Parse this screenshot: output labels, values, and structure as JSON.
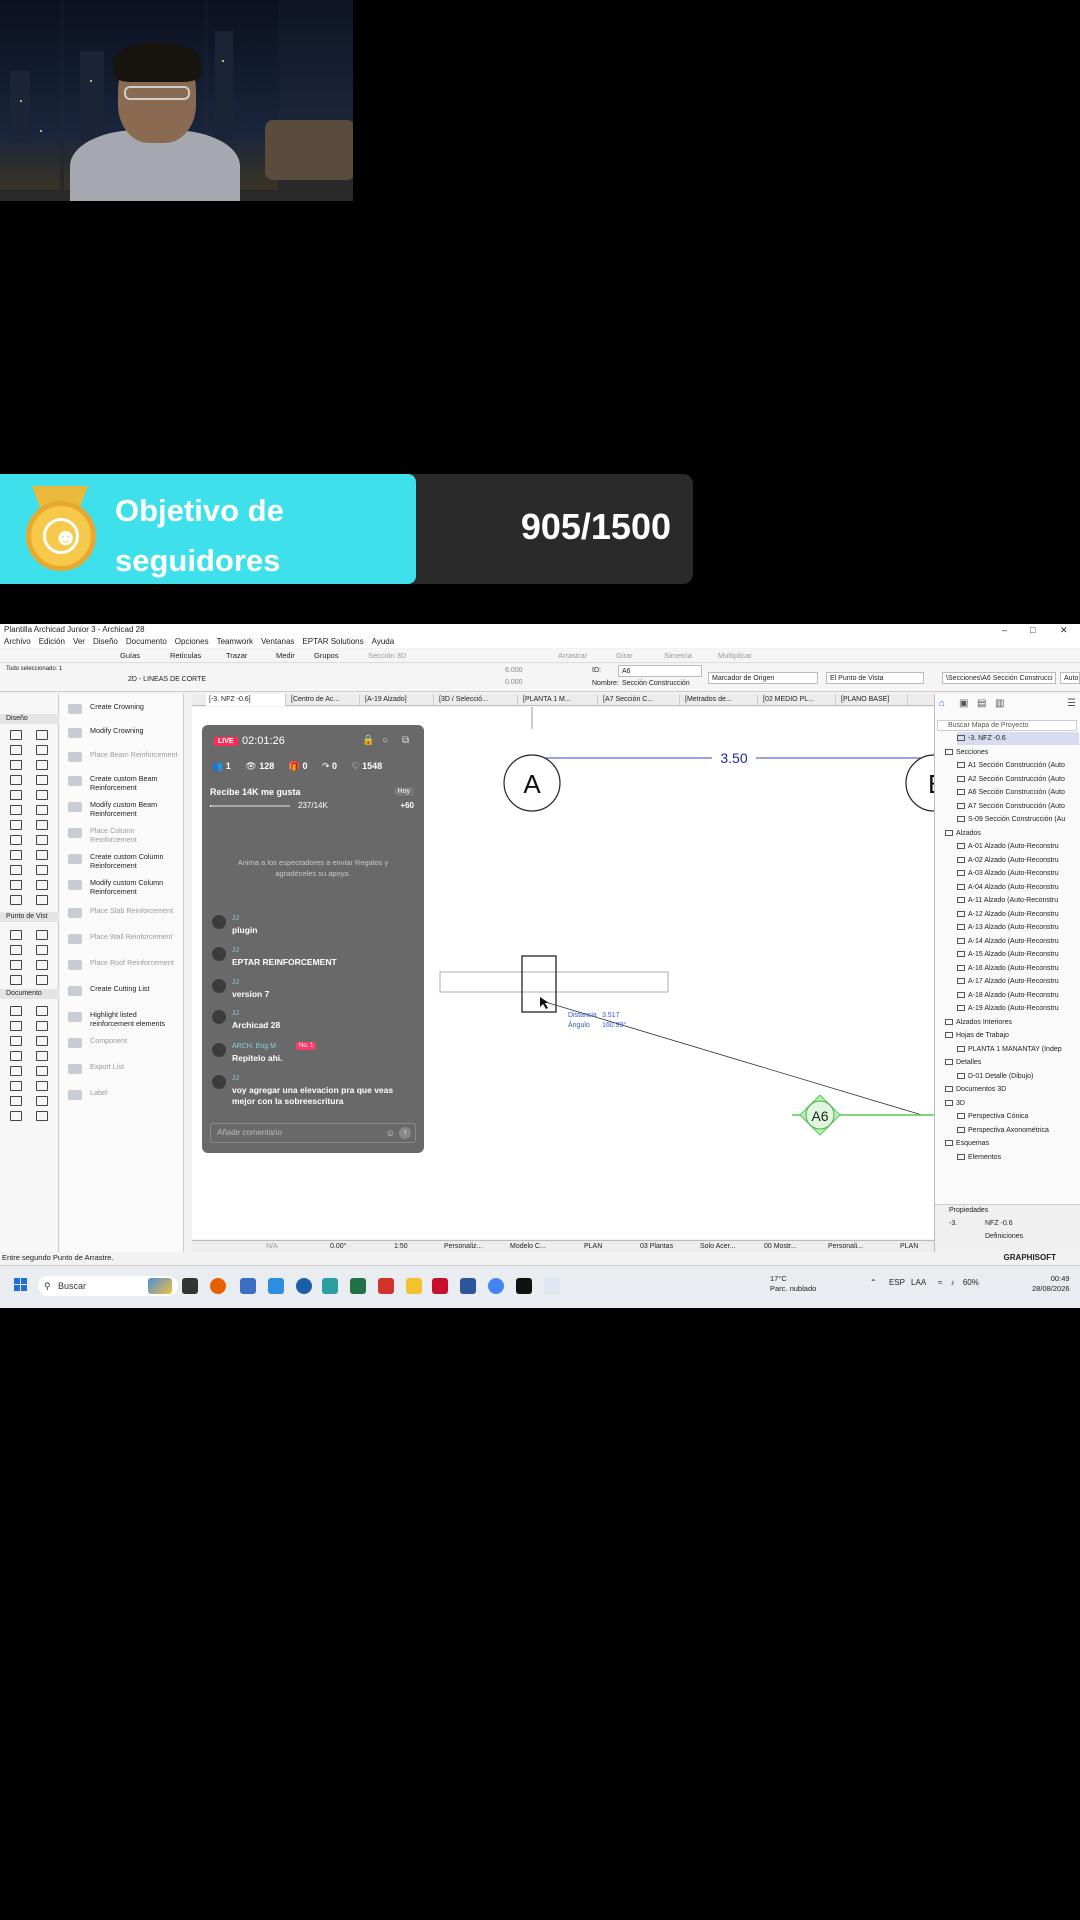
{
  "goal": {
    "title": "Objetivo de seguidores",
    "count": "905/1500"
  },
  "app": {
    "window_title": "Plantilla Archicad Junior 3 - Archicad 28",
    "menu": [
      "Archivo",
      "Edición",
      "Ver",
      "Diseño",
      "Documento",
      "Opciones",
      "Teamwork",
      "Ventanas",
      "EPTAR Solutions",
      "Ayuda"
    ],
    "toolbar": {
      "guides": "Guías",
      "grids": "Retículas",
      "trace": "Trazar",
      "measure": "Medir",
      "groups": "Grupos",
      "section3d": "Sección 3D",
      "drag": "Arrastrar",
      "rotate": "Girar",
      "mirror": "Simetría",
      "multiply": "Multiplicar"
    },
    "infobox": {
      "all_selected": "Todo seleccionado: 1",
      "view_2d": "2D - LINEAS DE CORTE",
      "val_a": "6.000",
      "val_b": "0.000",
      "id_label": "ID:",
      "id_value": "A6",
      "name_label": "Nombre:",
      "name_value": "Sección Construcción",
      "marker": "Marcador de Origen",
      "viewpoint": "El Punto de Vista",
      "path": "\\Secciones\\A6 Sección Construcci",
      "auto": "Auto"
    },
    "toolbox_sections": [
      "Diseño",
      "Punto de Vist",
      "Documento"
    ],
    "palette": [
      {
        "label": "Create Crowning",
        "dim": false
      },
      {
        "label": "Modify Crowning",
        "dim": false
      },
      {
        "label": "Place Beam Reinforcement",
        "dim": true
      },
      {
        "label": "Create custom Beam Reinforcement",
        "dim": false
      },
      {
        "label": "Modify custom Beam Reinforcement",
        "dim": false
      },
      {
        "label": "Place Column Reinforcement",
        "dim": true
      },
      {
        "label": "Create custom Column Reinforcement",
        "dim": false
      },
      {
        "label": "Modify custom Column Reinforcement",
        "dim": false
      },
      {
        "label": "Place Slab Reinforcement",
        "dim": true
      },
      {
        "label": "Place Wall Reinforcement",
        "dim": true
      },
      {
        "label": "Place Roof Reinforcement",
        "dim": true
      },
      {
        "label": "Create Cutting List",
        "dim": false
      },
      {
        "label": "Highlight listed reinforcement elements",
        "dim": false
      },
      {
        "label": "Component",
        "dim": true
      },
      {
        "label": "Export List",
        "dim": true
      },
      {
        "label": "Label",
        "dim": true
      }
    ],
    "tabs": [
      "[-3. NFZ -0.6]",
      "[Centro de Ac...",
      "[A-19 Alzado]",
      "[3D / Selecció...",
      "[PLANTA 1 M...",
      "[A7 Sección C...",
      "[Metrados de...",
      "[02 MEDIO PL...",
      "[PLANO BASE]"
    ],
    "canvas": {
      "dimension": "3.50",
      "grid_a": "A",
      "grid_b": "B",
      "marker": "A6",
      "tracker_dist_label": "Distancia",
      "tracker_dist": "3.517",
      "tracker_angle_label": "Ángulo",
      "tracker_angle": "160.99°"
    },
    "navigator": {
      "search_placeholder": "Buscar Mapa de Proyecto",
      "items": [
        {
          "label": "-3. NFZ -0.6",
          "indent": 1,
          "sel": true
        },
        {
          "label": "Secciones",
          "indent": 0,
          "sel": false
        },
        {
          "label": "A1 Sección Construcción (Auto",
          "indent": 1,
          "sel": false
        },
        {
          "label": "A2 Sección Construcción (Auto",
          "indent": 1,
          "sel": false
        },
        {
          "label": "A6 Sección Construcción (Auto",
          "indent": 1,
          "sel": false
        },
        {
          "label": "A7 Sección Construcción (Auto",
          "indent": 1,
          "sel": false
        },
        {
          "label": "S-09 Sección Construcción (Au",
          "indent": 1,
          "sel": false
        },
        {
          "label": "Alzados",
          "indent": 0,
          "sel": false
        },
        {
          "label": "A-01 Alzado (Auto-Reconstru",
          "indent": 1,
          "sel": false
        },
        {
          "label": "A-02 Alzado (Auto-Reconstru",
          "indent": 1,
          "sel": false
        },
        {
          "label": "A-03 Alzado (Auto-Reconstru",
          "indent": 1,
          "sel": false
        },
        {
          "label": "A-04 Alzado (Auto-Reconstru",
          "indent": 1,
          "sel": false
        },
        {
          "label": "A-11 Alzado (Auto-Reconstru",
          "indent": 1,
          "sel": false
        },
        {
          "label": "A-12 Alzado (Auto-Reconstru",
          "indent": 1,
          "sel": false
        },
        {
          "label": "A-13 Alzado (Auto-Reconstru",
          "indent": 1,
          "sel": false
        },
        {
          "label": "A-14 Alzado (Auto-Reconstru",
          "indent": 1,
          "sel": false
        },
        {
          "label": "A-15 Alzado (Auto-Reconstru",
          "indent": 1,
          "sel": false
        },
        {
          "label": "A-16 Alzado (Auto-Reconstru",
          "indent": 1,
          "sel": false
        },
        {
          "label": "A-17 Alzado (Auto-Reconstru",
          "indent": 1,
          "sel": false
        },
        {
          "label": "A-18 Alzado (Auto-Reconstru",
          "indent": 1,
          "sel": false
        },
        {
          "label": "A-19 Alzado (Auto-Reconstru",
          "indent": 1,
          "sel": false
        },
        {
          "label": "Alzados Interiores",
          "indent": 0,
          "sel": false
        },
        {
          "label": "Hojas de Trabajo",
          "indent": 0,
          "sel": false
        },
        {
          "label": "PLANTA 1 MANANTAY (Indep",
          "indent": 1,
          "sel": false
        },
        {
          "label": "Detalles",
          "indent": 0,
          "sel": false
        },
        {
          "label": "D-01 Detalle (Dibujo)",
          "indent": 1,
          "sel": false
        },
        {
          "label": "Documentos 3D",
          "indent": 0,
          "sel": false
        },
        {
          "label": "3D",
          "indent": 0,
          "sel": false
        },
        {
          "label": "Perspectiva Cónica",
          "indent": 1,
          "sel": false
        },
        {
          "label": "Perspectiva Axonométrica",
          "indent": 1,
          "sel": false
        },
        {
          "label": "Esquemas",
          "indent": 0,
          "sel": false
        },
        {
          "label": "Elementos",
          "indent": 1,
          "sel": false
        }
      ],
      "props_label": "Propiedades",
      "props_id": "-3.",
      "props_value": "NFZ -0.6",
      "definitions": "Definiciones"
    },
    "statusbar": {
      "na": "N/A",
      "angle": "0.00°",
      "scale": "1:50",
      "custom": "Personaliz...",
      "model": "Modelo C...",
      "plan": "PLAN",
      "floors": "03 Plantas",
      "only": "Solo Acer...",
      "show": "00 Mostr...",
      "custom2": "Personali...",
      "plan2": "PLAN"
    },
    "footer_hint": "Entre segundo Punto de Arrastre.",
    "brand": "GRAPHISOFT"
  },
  "live": {
    "badge": "LIVE",
    "timer": "02:01:26",
    "stats": {
      "mutual": "1",
      "viewers": "128",
      "gifts": "0",
      "shares": "0",
      "likes": "1548"
    },
    "goal_title": "Recibe 14K me gusta",
    "today": "Hoy",
    "progress_text": "237/14K",
    "progress_fraction": 0.017,
    "plus": "+60",
    "note": "Anima a los espectadores a enviar Regalos y agradéceles su apoyo.",
    "messages": [
      {
        "user": "JJ",
        "text": "plugin",
        "rank": ""
      },
      {
        "user": "JJ",
        "text": "EPTAR REINFORCEMENT",
        "rank": ""
      },
      {
        "user": "JJ",
        "text": "version 7",
        "rank": ""
      },
      {
        "user": "JJ",
        "text": "Archicad 28",
        "rank": ""
      },
      {
        "user": "ARCH. Eng M",
        "text": "Repitelo ahi.",
        "rank": "No. 1"
      },
      {
        "user": "JJ",
        "text": "voy agregar una elevacion pra que veas mejor con la sobreescritura",
        "rank": ""
      }
    ],
    "comment_placeholder": "Añade comentario"
  },
  "taskbar": {
    "search": "Buscar",
    "weather_temp": "17°C",
    "weather_desc": "Parc. nublado",
    "lang": "ESP",
    "layout": "LAA",
    "battery": "60%",
    "time": "00:49",
    "date": "28/08/2026"
  }
}
